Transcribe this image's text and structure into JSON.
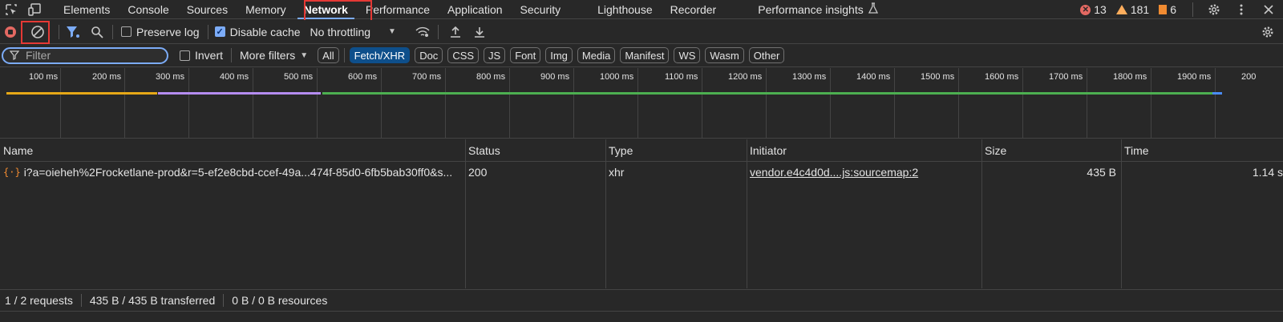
{
  "tabs": [
    "Elements",
    "Console",
    "Sources",
    "Memory",
    "Network",
    "Performance",
    "Application",
    "Security",
    "Lighthouse",
    "Recorder",
    "Performance insights"
  ],
  "active_tab": "Network",
  "counts": {
    "errors": "13",
    "warnings": "181",
    "issues": "6"
  },
  "toolbar": {
    "preserve_log_label": "Preserve log",
    "disable_cache_label": "Disable cache",
    "throttling_label": "No throttling"
  },
  "filter": {
    "placeholder": "Filter",
    "invert_label": "Invert",
    "more_filters_label": "More filters",
    "types": [
      "All",
      "Fetch/XHR",
      "Doc",
      "CSS",
      "JS",
      "Font",
      "Img",
      "Media",
      "Manifest",
      "WS",
      "Wasm",
      "Other"
    ],
    "active_type": "Fetch/XHR"
  },
  "overview": {
    "tick_labels": [
      "100 ms",
      "200 ms",
      "300 ms",
      "400 ms",
      "500 ms",
      "600 ms",
      "700 ms",
      "800 ms",
      "900 ms",
      "1000 ms",
      "1100 ms",
      "1200 ms",
      "1300 ms",
      "1400 ms",
      "1500 ms",
      "1600 ms",
      "1700 ms",
      "1800 ms",
      "1900 ms",
      "200"
    ]
  },
  "table": {
    "columns": [
      "Name",
      "Status",
      "Type",
      "Initiator",
      "Size",
      "Time"
    ],
    "rows": [
      {
        "name": "i?a=oieheh%2Frocketlane-prod&r=5-ef2e8cbd-ccef-49a...474f-85d0-6fb5bab30ff0&s...",
        "status": "200",
        "type": "xhr",
        "initiator": "vendor.e4c4d0d....js:sourcemap:2",
        "size": "435 B",
        "time": "1.14 s"
      }
    ]
  },
  "statusbar": {
    "requests": "1 / 2 requests",
    "transferred": "435 B / 435 B transferred",
    "resources": "0 B / 0 B resources"
  },
  "colors": {
    "accent": "#7cacf8",
    "highlight_box": "#e53935",
    "chip_active": "#0e4f8b"
  }
}
